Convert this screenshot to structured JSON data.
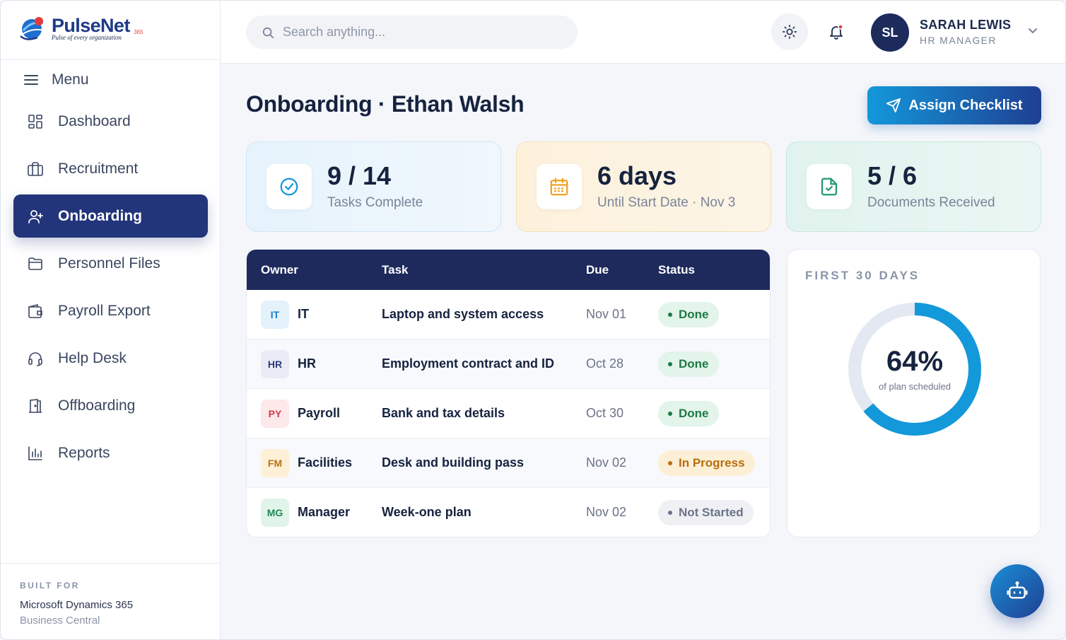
{
  "brand": {
    "name": "PulseNet",
    "superscript": "365",
    "tagline": "Pulse of every organization"
  },
  "sidebar": {
    "menu_label": "Menu",
    "items": [
      {
        "label": "Dashboard",
        "icon": "dashboard-icon",
        "active": false
      },
      {
        "label": "Recruitment",
        "icon": "briefcase-icon",
        "active": false
      },
      {
        "label": "Onboarding",
        "icon": "user-plus-icon",
        "active": true
      },
      {
        "label": "Personnel Files",
        "icon": "folder-icon",
        "active": false
      },
      {
        "label": "Payroll Export",
        "icon": "wallet-icon",
        "active": false
      },
      {
        "label": "Help Desk",
        "icon": "headset-icon",
        "active": false
      },
      {
        "label": "Offboarding",
        "icon": "door-exit-icon",
        "active": false
      },
      {
        "label": "Reports",
        "icon": "bar-chart-icon",
        "active": false
      }
    ],
    "footer": {
      "built_for": "BUILT FOR",
      "product": "Microsoft Dynamics 365",
      "product_sub": "Business Central"
    }
  },
  "topbar": {
    "search_placeholder": "Search anything...",
    "user": {
      "initials": "SL",
      "name": "SARAH LEWIS",
      "role": "HR MANAGER"
    },
    "notification_dot_color": "#e53935"
  },
  "page": {
    "title": "Onboarding · Ethan Walsh",
    "assign_button": "Assign Checklist"
  },
  "stats": [
    {
      "value": "9 / 14",
      "label": "Tasks Complete",
      "icon": "check-circle-icon",
      "color": "#1398da"
    },
    {
      "value": "6 days",
      "label": "Until Start Date · Nov 3",
      "icon": "calendar-icon",
      "color": "#f0a020"
    },
    {
      "value": "5 / 6",
      "label": "Documents Received",
      "icon": "document-check-icon",
      "color": "#1f9a6b"
    }
  ],
  "table": {
    "columns": [
      "Owner",
      "Task",
      "Due",
      "Status"
    ],
    "rows": [
      {
        "chip": "IT",
        "chip_bg": "#e3f2fb",
        "chip_fg": "#1a7fc0",
        "owner": "IT",
        "task": "Laptop and system access",
        "due": "Nov 01",
        "status": "Done",
        "status_type": "done"
      },
      {
        "chip": "HR",
        "chip_bg": "#ebebf7",
        "chip_fg": "#2c3a7a",
        "owner": "HR",
        "task": "Employment contract and ID",
        "due": "Oct 28",
        "status": "Done",
        "status_type": "done"
      },
      {
        "chip": "PY",
        "chip_bg": "#fde8ea",
        "chip_fg": "#d13a4c",
        "owner": "Payroll",
        "task": "Bank and tax details",
        "due": "Oct 30",
        "status": "Done",
        "status_type": "done"
      },
      {
        "chip": "FM",
        "chip_bg": "#fdf0d6",
        "chip_fg": "#b87010",
        "owner": "Facilities",
        "task": "Desk and building pass",
        "due": "Nov 02",
        "status": "In Progress",
        "status_type": "progress"
      },
      {
        "chip": "MG",
        "chip_bg": "#e1f4ea",
        "chip_fg": "#1d8a52",
        "owner": "Manager",
        "task": "Week-one plan",
        "due": "Nov 02",
        "status": "Not Started",
        "status_type": "notstarted"
      }
    ]
  },
  "progress_card": {
    "title": "FIRST 30 DAYS",
    "percent_label": "64%",
    "percent": 64,
    "subtitle": "of plan scheduled",
    "ring_color": "#1398da",
    "track_color": "#e4e8f2"
  }
}
